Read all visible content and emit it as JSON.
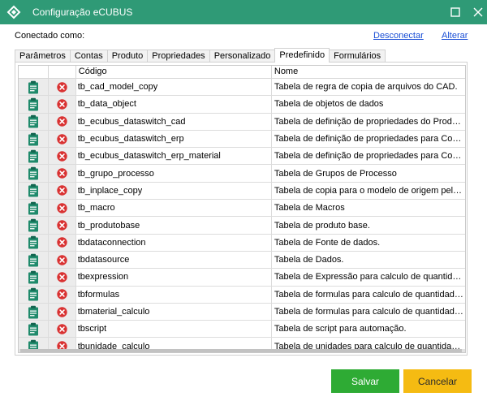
{
  "window": {
    "title": "Configuração eCUBUS",
    "maximize_icon": "maximize-icon",
    "close_icon": "close-icon",
    "app_icon": "ecubus-logo-icon"
  },
  "connection": {
    "label": "Conectado como:",
    "disconnect_link": "Desconectar",
    "change_link": "Alterar"
  },
  "tabs": [
    {
      "label": "Parâmetros",
      "active": false
    },
    {
      "label": "Contas",
      "active": false
    },
    {
      "label": "Produto",
      "active": false
    },
    {
      "label": "Propriedades",
      "active": false
    },
    {
      "label": "Personalizado",
      "active": false
    },
    {
      "label": "Predefinido",
      "active": true
    },
    {
      "label": "Formulários",
      "active": false
    }
  ],
  "grid": {
    "columns": {
      "code": "Código",
      "name": "Nome"
    },
    "edit_icon": "clipboard-edit-icon",
    "delete_icon": "delete-x-icon",
    "rows": [
      {
        "code": "tb_cad_model_copy",
        "name": "Tabela de regra de copia de arquivos do CAD."
      },
      {
        "code": "tb_data_object",
        "name": "Tabela de objetos de dados"
      },
      {
        "code": "tb_ecubus_dataswitch_cad",
        "name": "Tabela de definição de propriedades do Produto para..."
      },
      {
        "code": "tb_ecubus_dataswitch_erp",
        "name": "Tabela de definição de propriedades para Comutar d..."
      },
      {
        "code": "tb_ecubus_dataswitch_erp_material",
        "name": "Tabela de definição de propriedades para Comutar d..."
      },
      {
        "code": "tb_grupo_processo",
        "name": "Tabela de Grupos de Processo"
      },
      {
        "code": "tb_inplace_copy",
        "name": "Tabela de copia para o modelo de origem pelo modo ..."
      },
      {
        "code": "tb_macro",
        "name": "Tabela de Macros"
      },
      {
        "code": "tb_produtobase",
        "name": "Tabela de produto base."
      },
      {
        "code": "tbdataconnection",
        "name": "Tabela de Fonte de dados."
      },
      {
        "code": "tbdatasource",
        "name": "Tabela de Dados."
      },
      {
        "code": "tbexpression",
        "name": "Tabela de Expressão para calculo de quantidade bruta."
      },
      {
        "code": "tbformulas",
        "name": "Tabela de formulas para calculo de quantidade bruta."
      },
      {
        "code": "tbmaterial_calculo",
        "name": "Tabela de formulas para calculo de quantidade bruta ..."
      },
      {
        "code": "tbscript",
        "name": "Tabela de script para automação."
      },
      {
        "code": "tbunidade_calculo",
        "name": "Tabela de unidades para calculo de quantidade bruta..."
      }
    ]
  },
  "buttons": {
    "save": "Salvar",
    "cancel": "Cancelar"
  },
  "colors": {
    "titlebar": "#2f9a76",
    "save": "#2eab34",
    "cancel": "#f5bb12",
    "edit_icon": "#1f8a6b",
    "delete_icon": "#d93232"
  }
}
